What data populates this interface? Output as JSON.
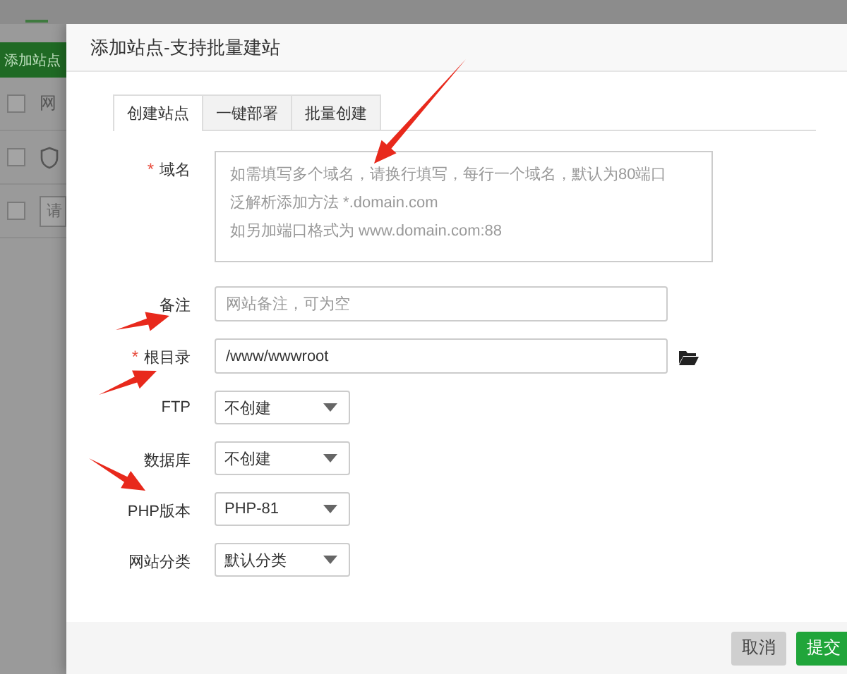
{
  "background": {
    "add_button": "添加站点",
    "rows": [
      {
        "kind": "header",
        "checked": false,
        "text": "网"
      },
      {
        "kind": "icon",
        "checked": false
      },
      {
        "kind": "filter",
        "checked": false,
        "placeholder": "请"
      }
    ]
  },
  "dialog": {
    "title": "添加站点-支持批量建站",
    "tabs": [
      {
        "label": "创建站点",
        "selected": true
      },
      {
        "label": "一键部署",
        "selected": false
      },
      {
        "label": "批量创建",
        "selected": false
      }
    ],
    "fields": [
      {
        "kind": "textarea",
        "label": "域名",
        "required_mark": "*",
        "placeholder_lines": [
          "如需填写多个域名，请换行填写，每行一个域名，默认为80端口",
          "泛解析添加方法 *.domain.com",
          "如另加端口格式为 www.domain.com:88"
        ]
      },
      {
        "kind": "input",
        "label": "备注",
        "placeholder": "网站备注，可为空"
      },
      {
        "kind": "path",
        "label": "根目录",
        "required_mark": "*",
        "value": "/www/wwwroot"
      },
      {
        "kind": "select",
        "label": "FTP",
        "value": "不创建"
      },
      {
        "kind": "select",
        "label": "数据库",
        "value": "不创建"
      },
      {
        "kind": "select",
        "label": "PHP版本",
        "value": "PHP-81"
      },
      {
        "kind": "select",
        "label": "网站分类",
        "value": "默认分类"
      }
    ],
    "buttons": [
      {
        "label": "取消",
        "kind": "secondary"
      },
      {
        "label": "提交",
        "kind": "primary"
      }
    ]
  }
}
